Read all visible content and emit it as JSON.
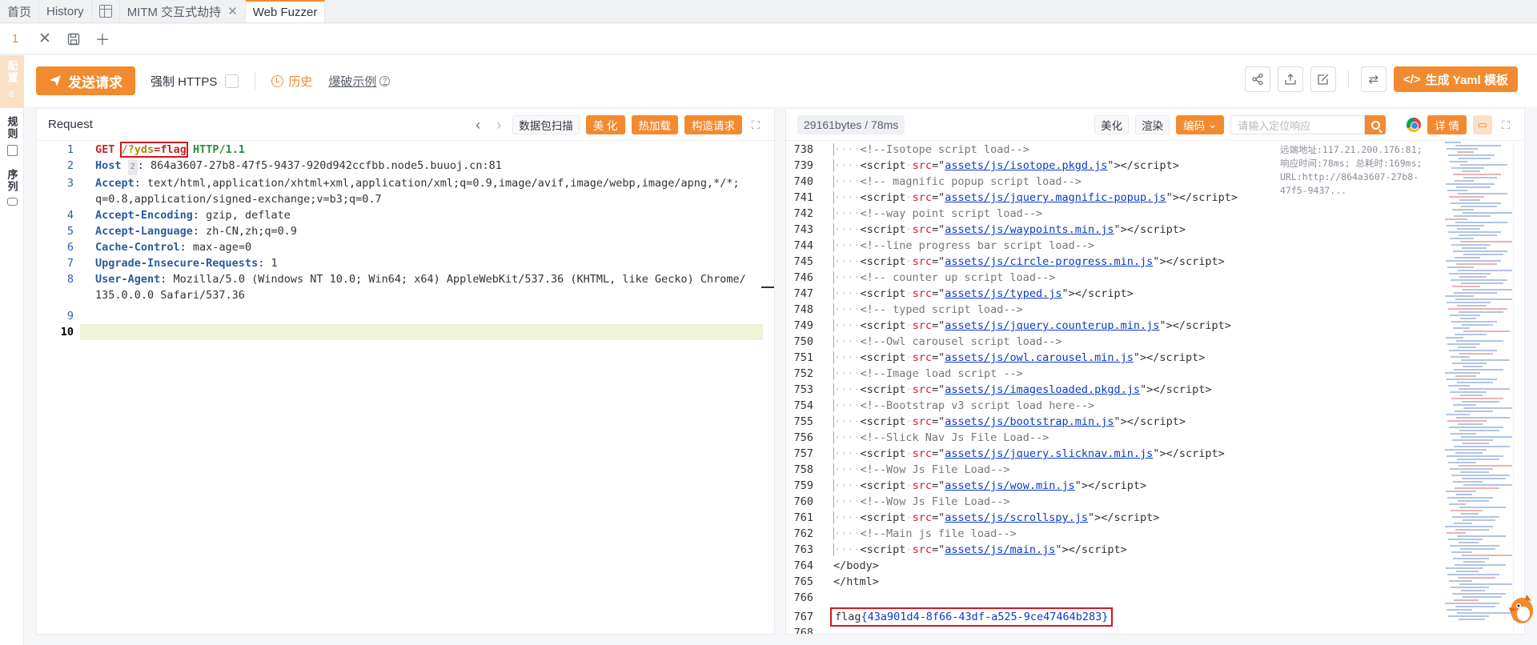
{
  "tabs": [
    {
      "label": "首页"
    },
    {
      "label": "History"
    },
    {
      "label": ""
    },
    {
      "label": "MITM 交互式劫持"
    },
    {
      "label": "Web Fuzzer"
    }
  ],
  "subtab": {
    "number": "1"
  },
  "rail": {
    "items": [
      {
        "label": "配置"
      },
      {
        "label": "规则"
      },
      {
        "label": "序列"
      }
    ]
  },
  "actions": {
    "send": "发送请求",
    "force_https": "强制 HTTPS",
    "history": "历史",
    "example": "爆破示例",
    "yaml": "生成 Yaml 模板"
  },
  "request": {
    "title": "Request",
    "scan": "数据包扫描",
    "beautify": "美 化",
    "hotload": "热加载",
    "build": "构造请求",
    "lines": [
      {
        "n": "1"
      },
      {
        "n": "2"
      },
      {
        "n": "3"
      },
      {
        "n": ""
      },
      {
        "n": "4"
      },
      {
        "n": "5"
      },
      {
        "n": "6"
      },
      {
        "n": "7"
      },
      {
        "n": "8"
      },
      {
        "n": ""
      },
      {
        "n": "9"
      },
      {
        "n": "10"
      }
    ],
    "text": {
      "method": "GET",
      "path_prefix": "/?",
      "param": "yds",
      "eq": "=",
      "value": "flag",
      "proto": "HTTP/1.1",
      "host_k": "Host",
      "host_v": ": 864a3607-27b8-47f5-9437-920d942ccfbb.node5.buuoj.cn:81",
      "accept_k": "Accept",
      "accept_v": ": text/html,application/xhtml+xml,application/xml;q=0.9,image/avif,image/webp,image/apng,*/*;",
      "accept_v2": "q=0.8,application/signed-exchange;v=b3;q=0.7",
      "enc_k": "Accept-Encoding",
      "enc_v": ": gzip, deflate",
      "lang_k": "Accept-Language",
      "lang_v": ": zh-CN,zh;q=0.9",
      "cache_k": "Cache-Control",
      "cache_v": ": max-age=0",
      "upg_k": "Upgrade-Insecure-Requests",
      "upg_v": ": 1",
      "ua_k": "User-Agent",
      "ua_v": ": Mozilla/5.0 (Windows NT 10.0; Win64; x64) AppleWebKit/537.36 (KHTML, like Gecko) Chrome/",
      "ua_v2": "135.0.0.0 Safari/537.36"
    }
  },
  "response": {
    "size": "29161bytes / 78ms",
    "beautify": "美化",
    "render": "渲染",
    "encode": "编码",
    "search_placeholder": "请输入定位响应",
    "detail": "详 情",
    "remote_info": "远端地址:117.21.200.176:81; 响应时间:78ms; 总耗时:169ms; URL:http://864a3607-27b8-47f5-9437...",
    "lines": [
      {
        "n": "738",
        "kind": "c",
        "t": "<!--Isotope script load-->"
      },
      {
        "n": "739",
        "kind": "s",
        "t": "assets/js/isotope.pkgd.js"
      },
      {
        "n": "740",
        "kind": "c",
        "t": "<!-- magnific popup script load-->"
      },
      {
        "n": "741",
        "kind": "s",
        "t": "assets/js/jquery.magnific-popup.js"
      },
      {
        "n": "742",
        "kind": "c",
        "t": "<!--way point script load-->"
      },
      {
        "n": "743",
        "kind": "s",
        "t": "assets/js/waypoints.min.js"
      },
      {
        "n": "744",
        "kind": "c",
        "t": "<!--line progress bar script load-->"
      },
      {
        "n": "745",
        "kind": "s",
        "t": "assets/js/circle-progress.min.js"
      },
      {
        "n": "746",
        "kind": "c",
        "t": "<!-- counter up script load-->"
      },
      {
        "n": "747",
        "kind": "s",
        "t": "assets/js/typed.js"
      },
      {
        "n": "748",
        "kind": "c",
        "t": "<!-- typed script load-->"
      },
      {
        "n": "749",
        "kind": "s",
        "t": "assets/js/jquery.counterup.min.js"
      },
      {
        "n": "750",
        "kind": "c",
        "t": "<!--Owl carousel script load-->"
      },
      {
        "n": "751",
        "kind": "s",
        "t": "assets/js/owl.carousel.min.js"
      },
      {
        "n": "752",
        "kind": "c",
        "t": "<!--Image load script -->"
      },
      {
        "n": "753",
        "kind": "s",
        "t": "assets/js/imagesloaded.pkgd.js"
      },
      {
        "n": "754",
        "kind": "c",
        "t": "<!--Bootstrap v3 script load here-->"
      },
      {
        "n": "755",
        "kind": "s",
        "t": "assets/js/bootstrap.min.js"
      },
      {
        "n": "756",
        "kind": "c",
        "t": "<!--Slick Nav Js File Load-->"
      },
      {
        "n": "757",
        "kind": "s",
        "t": "assets/js/jquery.slicknav.min.js"
      },
      {
        "n": "758",
        "kind": "c",
        "t": "<!--Wow Js File Load-->"
      },
      {
        "n": "759",
        "kind": "s",
        "t": "assets/js/wow.min.js"
      },
      {
        "n": "760",
        "kind": "c",
        "t": "<!--Wow Js File Load-->"
      },
      {
        "n": "761",
        "kind": "s",
        "t": "assets/js/scrollspy.js"
      },
      {
        "n": "762",
        "kind": "c",
        "t": "<!--Main js file load-->"
      },
      {
        "n": "763",
        "kind": "s",
        "t": "assets/js/main.js"
      },
      {
        "n": "764",
        "kind": "p",
        "t": "</body>"
      },
      {
        "n": "765",
        "kind": "p",
        "t": "</html>"
      },
      {
        "n": "766",
        "kind": "e",
        "t": ""
      },
      {
        "n": "767",
        "kind": "f",
        "t": ""
      },
      {
        "n": "768",
        "kind": "e",
        "t": ""
      }
    ],
    "flag_prefix": "flag",
    "flag_value": "{43a901d4-8f66-43df-a525-9ce47464b283}"
  },
  "colors": {
    "accent": "#f28b2f",
    "flag_box": "#d8141b"
  }
}
